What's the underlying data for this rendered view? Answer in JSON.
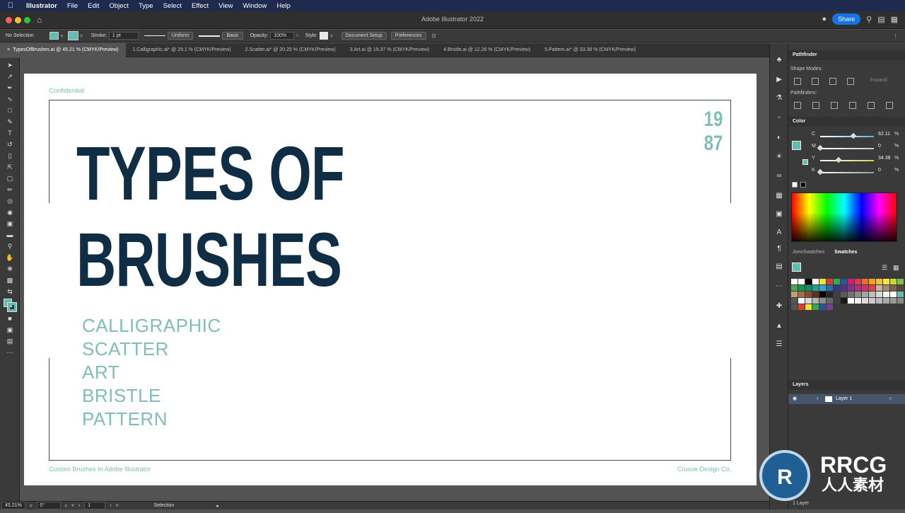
{
  "menubar": {
    "app": "Illustrator",
    "items": [
      "File",
      "Edit",
      "Object",
      "Type",
      "Select",
      "Effect",
      "View",
      "Window",
      "Help"
    ]
  },
  "window": {
    "title": "Adobe Illustrator 2022",
    "share_label": "Share"
  },
  "control": {
    "selection": "No Selection",
    "stroke_label": "Stroke:",
    "stroke_value": "1 pt",
    "profile": "Uniform",
    "brush": "Basic",
    "opacity_label": "Opacity:",
    "opacity_value": "100%",
    "style_label": "Style:",
    "document_setup": "Document Setup",
    "preferences": "Preferences"
  },
  "tabs": [
    "TypesOfBrushes.ai @ 45.21 % (CMYK/Preview)",
    "1.Calligraphic.ai* @ 29.1 % (CMYK/Preview)",
    "2.Scatter.ai* @ 20.25 % (CMYK/Preview)",
    "3.Art.ai @ 19.37 % (CMYK/Preview)",
    "4.Bristle.ai @ 12.26 % (CMYK/Preview)",
    "5.Pattern.ai* @ 33.38 % (CMYK/Preview)"
  ],
  "artboard": {
    "confidential": "Confidential",
    "title_line1": "TYPES OF",
    "title_line2": "BRUSHES",
    "year_line1": "19",
    "year_line2": "87",
    "brushes": [
      "CALLIGRAPHIC",
      "SCATTER",
      "ART",
      "BRISTLE",
      "PATTERN"
    ],
    "footer_left": "Custom Brushes In Adobe Illustrator",
    "footer_right": "Crusoe Design Co."
  },
  "status": {
    "zoom": "45.21%",
    "rotation": "0°",
    "artboard_num": "1",
    "tool": "Selection"
  },
  "pathfinder": {
    "title": "Pathfinder",
    "shape_modes": "Shape Modes:",
    "pathfinders": "Pathfinders:",
    "expand": "Expand"
  },
  "color": {
    "title": "Color",
    "channels": [
      {
        "name": "C",
        "value": "62.11",
        "unit": "%",
        "fraction": 0.62,
        "color": "#4bbfd0"
      },
      {
        "name": "M",
        "value": "0",
        "unit": "%",
        "fraction": 0.0,
        "color": "#c9c9c9"
      },
      {
        "name": "Y",
        "value": "34.38",
        "unit": "%",
        "fraction": 0.34,
        "color": "#d6d34a"
      },
      {
        "name": "K",
        "value": "0",
        "unit": "%",
        "fraction": 0.0,
        "color": "#9a9a9a"
      }
    ],
    "fill_color": "#5ebeb2"
  },
  "swatches": {
    "tab1": "JonsSwatches",
    "tab2": "Swatches"
  },
  "layers": {
    "title": "Layers",
    "layer1": "Layer 1",
    "count": "1 Layer"
  },
  "colors": {
    "accent": "#7fbfb5",
    "title": "#0f2d44",
    "frame": "#3d4f6a"
  },
  "watermark": {
    "line1": "RRCG",
    "line2": "人人素材"
  }
}
